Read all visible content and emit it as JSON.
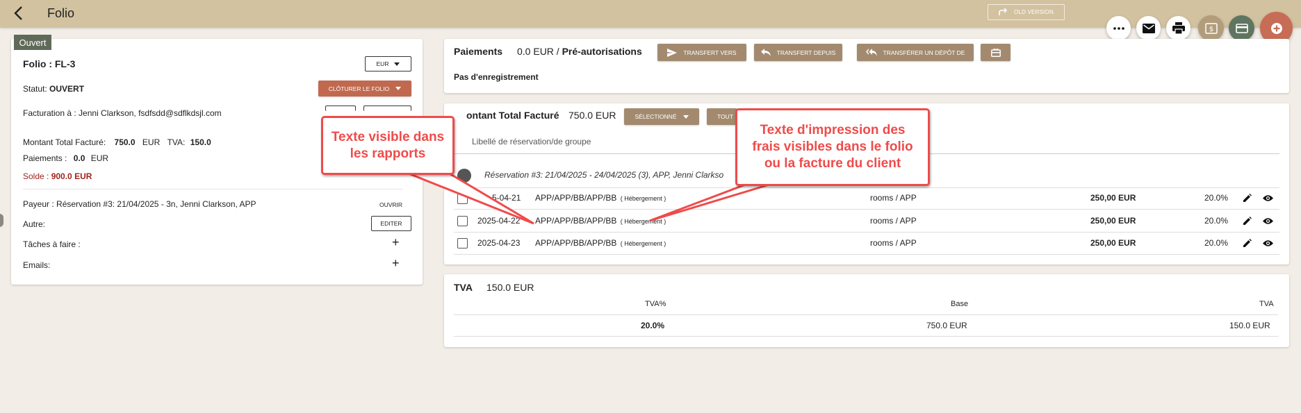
{
  "topbar": {
    "title": "Folio",
    "old_version": "OLD VERSION"
  },
  "left": {
    "status_badge": "Ouvert",
    "folio_label": "Folio : FL-3",
    "currency": "EUR",
    "statut_label": "Statut:",
    "statut_value": "OUVERT",
    "close_folio": "CLÔTURER LE FOLIO",
    "billing": "Facturation à : Jenni Clarkson, fsdfsdd@sdflkdsjl.com",
    "total_label": "Montant Total Facturé:",
    "total_value": "750.0",
    "total_currency": "EUR",
    "tva_label": "TVA:",
    "tva_value": "150.0",
    "payments_label": "Paiements :",
    "payments_value": "0.0",
    "payments_currency": "EUR",
    "solde_label": "Solde :",
    "solde_value": "900.0 EUR",
    "payer": "Payeur : Réservation #3: 21/04/2025 - 3n, Jenni Clarkson, APP",
    "open_btn": "OUVRIR",
    "other_label": "Autre:",
    "edit_btn": "EDITER",
    "tasks_label": "Tâches à faire :",
    "emails_label": "Emails:",
    "plus": "+"
  },
  "payments": {
    "title": "Paiements",
    "amount": "0.0 EUR /",
    "preauth": "Pré-autorisations",
    "btn_transfer_to": "TRANSFERT VERS",
    "btn_transfer_from": "TRANSFERT DEPUIS",
    "btn_transfer_deposit": "TRANSFÉRER UN DÉPÔT DE",
    "empty": "Pas d'enregistrement"
  },
  "charges": {
    "title": "ontant Total Facturé",
    "amount": "750.0 EUR",
    "selected_btn": "SÉLECTIONNÉ",
    "all_btn": "TOUT",
    "column_header": "Libellé de réservation/de groupe",
    "group": "Réservation #3: 21/04/2025 - 24/04/2025 (3), APP, Jenni Clarkso",
    "rows": [
      {
        "date": "5-04-21",
        "desc": "APP/APP/BB/APP/BB",
        "type": "( Hébergement )",
        "category": "rooms / APP",
        "amount": "250,00 EUR",
        "vat": "20.0%"
      },
      {
        "date": "2025-04-22",
        "desc": "APP/APP/BB/APP/BB",
        "type": "( Hébergement )",
        "category": "rooms / APP",
        "amount": "250,00 EUR",
        "vat": "20.0%"
      },
      {
        "date": "2025-04-23",
        "desc": "APP/APP/BB/APP/BB",
        "type": "( Hébergement )",
        "category": "rooms / APP",
        "amount": "250,00 EUR",
        "vat": "20.0%"
      }
    ]
  },
  "tva": {
    "title": "TVA",
    "amount": "150.0 EUR",
    "headers": [
      "TVA%",
      "Base",
      "TVA"
    ],
    "row": [
      "20.0%",
      "750.0 EUR",
      "150.0 EUR"
    ]
  },
  "callouts": {
    "left": "Texte visible dans les rapports",
    "right": "Texte d'impression des frais visibles dans le folio ou la facture du client"
  }
}
